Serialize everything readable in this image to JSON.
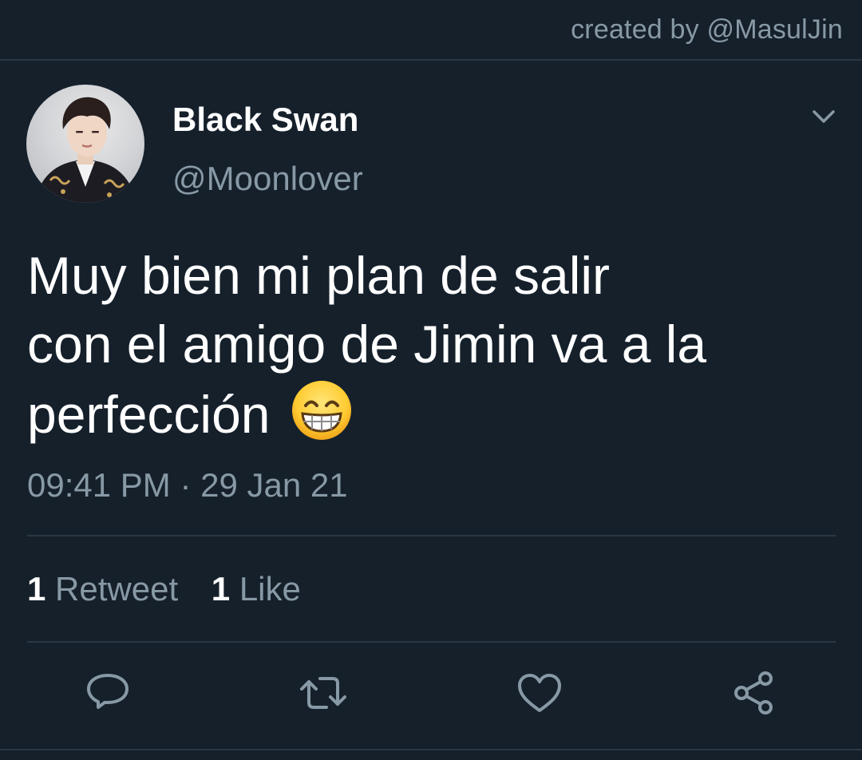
{
  "header": {
    "credit": "created by @MasulJin"
  },
  "tweet": {
    "author": {
      "display_name": "Black Swan",
      "handle": "@Moonlover",
      "avatar": "profile-photo"
    },
    "text_lines": [
      "Muy bien mi plan de salir",
      "con el amigo de Jimin va a la",
      "perfección"
    ],
    "emoji": "grinning-face-with-smiling-eyes",
    "time": "09:41 PM",
    "separator": "·",
    "date": "29 Jan 21",
    "stats": {
      "retweets_count": "1",
      "retweets_label": "Retweet",
      "likes_count": "1",
      "likes_label": "Like"
    }
  },
  "actions": [
    {
      "name": "reply",
      "icon": "speech-bubble-icon"
    },
    {
      "name": "retweet",
      "icon": "retweet-icon"
    },
    {
      "name": "like",
      "icon": "heart-icon"
    },
    {
      "name": "share",
      "icon": "share-icon"
    }
  ],
  "colors": {
    "background": "#15202b",
    "secondary_text": "#8899a6",
    "primary_text": "#ffffff",
    "divider": "#2a3744"
  }
}
